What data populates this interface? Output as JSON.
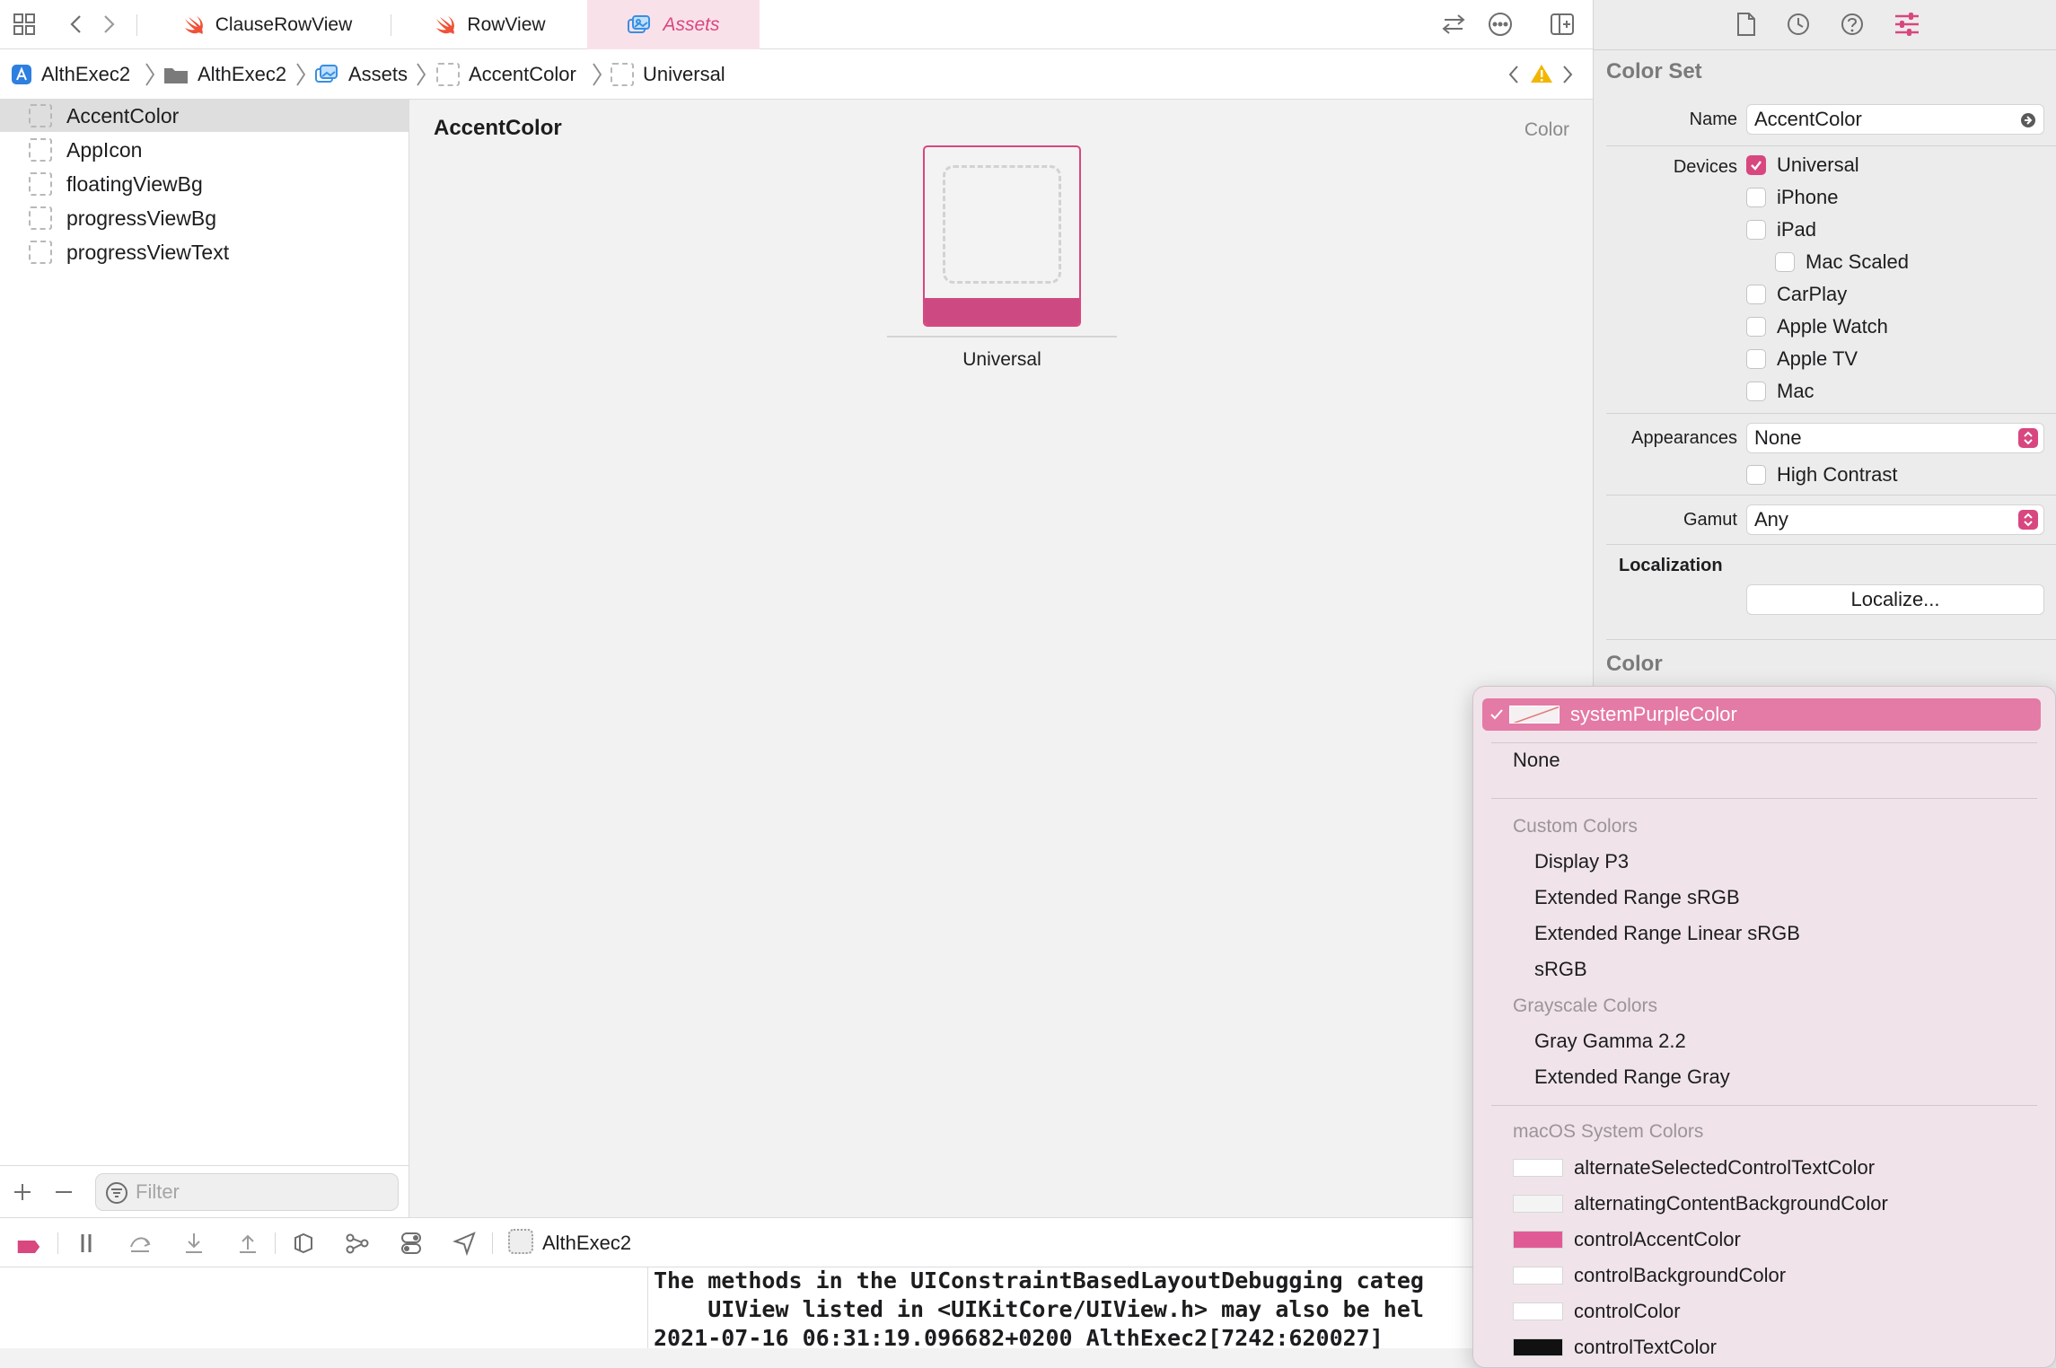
{
  "tabs": [
    {
      "label": "ClauseRowView",
      "icon": "swift-icon",
      "active": false
    },
    {
      "label": "RowView",
      "icon": "swift-icon",
      "active": false
    },
    {
      "label": "Assets",
      "icon": "asset-catalog-icon",
      "active": true
    }
  ],
  "breadcrumb": [
    {
      "label": "AlthExec2",
      "icon": "app-project-icon"
    },
    {
      "label": "AlthExec2",
      "icon": "folder-icon"
    },
    {
      "label": "Assets",
      "icon": "asset-catalog-icon"
    },
    {
      "label": "AccentColor",
      "icon": "color-set-icon"
    },
    {
      "label": "Universal",
      "icon": "color-set-icon"
    }
  ],
  "navigator": {
    "items": [
      {
        "label": "AccentColor",
        "selected": true
      },
      {
        "label": "AppIcon",
        "selected": false
      },
      {
        "label": "floatingViewBg",
        "selected": false
      },
      {
        "label": "progressViewBg",
        "selected": false
      },
      {
        "label": "progressViewText",
        "selected": false
      }
    ],
    "filter_placeholder": "Filter"
  },
  "editor": {
    "title": "AccentColor",
    "kind": "Color",
    "swatch_label": "Universal",
    "swatch_color": "#cc4a81"
  },
  "inspector": {
    "section_title": "Color Set",
    "name_label": "Name",
    "name_value": "AccentColor",
    "devices_label": "Devices",
    "devices": [
      {
        "label": "Universal",
        "checked": true
      },
      {
        "label": "iPhone",
        "checked": false
      },
      {
        "label": "iPad",
        "checked": false
      },
      {
        "label": "Mac Scaled",
        "checked": false
      },
      {
        "label": "CarPlay",
        "checked": false
      },
      {
        "label": "Apple Watch",
        "checked": false
      },
      {
        "label": "Apple TV",
        "checked": false
      },
      {
        "label": "Mac",
        "checked": false
      }
    ],
    "appearances_label": "Appearances",
    "appearances_value": "None",
    "high_contrast_label": "High Contrast",
    "gamut_label": "Gamut",
    "gamut_value": "Any",
    "localization_label": "Localization",
    "localize_button": "Localize...",
    "color_section": "Color"
  },
  "debugbar": {
    "scheme_label": "AlthExec2"
  },
  "console": {
    "lines": [
      "The methods in the UIConstraintBasedLayoutDebugging categ",
      "    UIView listed in <UIKitCore/UIView.h> may also be hel",
      "2021-07-16 06:31:19.096682+0200 AlthExec2[7242:620027]"
    ]
  },
  "menu": {
    "selected": "systemPurpleColor",
    "none_label": "None",
    "custom_header": "Custom Colors",
    "custom_items": [
      "Display P3",
      "Extended Range sRGB",
      "Extended Range Linear sRGB",
      "sRGB"
    ],
    "grayscale_header": "Grayscale Colors",
    "grayscale_items": [
      "Gray Gamma 2.2",
      "Extended Range Gray"
    ],
    "system_header": "macOS System Colors",
    "system_items": [
      {
        "label": "alternateSelectedControlTextColor",
        "color": "#ffffff"
      },
      {
        "label": "alternatingContentBackgroundColor",
        "color": "#f4f4f4"
      },
      {
        "label": "controlAccentColor",
        "color": "#e05b96"
      },
      {
        "label": "controlBackgroundColor",
        "color": "#ffffff"
      },
      {
        "label": "controlColor",
        "color": "#ffffff"
      },
      {
        "label": "controlTextColor",
        "color": "#111111"
      }
    ]
  },
  "colors": {
    "accent": "#d8477f",
    "menu_highlight": "#e47aa6"
  }
}
